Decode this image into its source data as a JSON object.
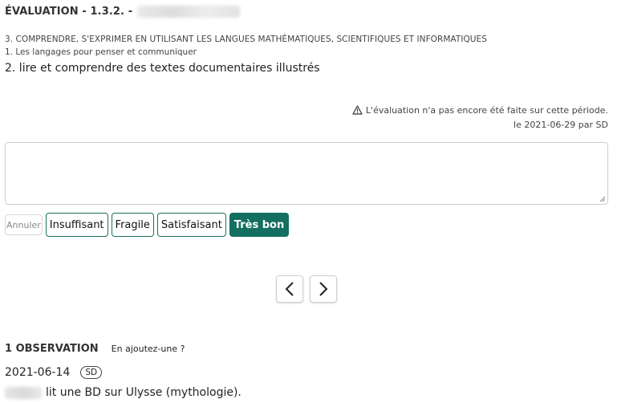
{
  "header": {
    "title": "ÉVALUATION - 1.3.2. -",
    "domain": "3. COMPRENDRE, S'EXPRIMER EN UTILISANT LES LANGUES MATHÉMATIQUES, SCIENTIFIQUES ET INFORMATIQUES",
    "subdomain": "1. Les langages pour penser et communiquer",
    "item": "2. lire et comprendre des textes documentaires illustrés"
  },
  "status": {
    "icon": "warning-icon",
    "message": "L'évaluation n'a pas encore été faite sur cette période.",
    "meta": "le 2021-06-29 par SD"
  },
  "comment": {
    "value": "",
    "placeholder": ""
  },
  "levels": {
    "cancel_label": "Annuler",
    "options": [
      "Insuffisant",
      "Fragile",
      "Satisfaisant",
      "Très bon"
    ],
    "selected": "Très bon"
  },
  "nav": {
    "prev_icon": "chevron-left-icon",
    "next_icon": "chevron-right-icon"
  },
  "observations": {
    "count_label": "1 OBSERVATION",
    "add_label": "En ajoutez-une ?",
    "items": [
      {
        "date": "2021-06-14",
        "author": "SD",
        "text": "lit une BD sur Ulysse (mythologie)."
      }
    ]
  },
  "colors": {
    "accent": "#136f60"
  }
}
